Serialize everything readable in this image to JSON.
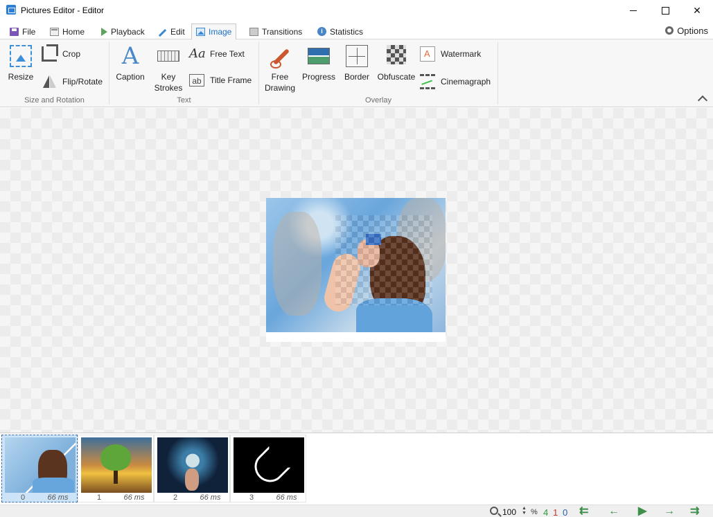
{
  "window": {
    "title": "Pictures Editor - Editor"
  },
  "tabs": [
    {
      "label": "File",
      "icon": "save-icon"
    },
    {
      "label": "Home",
      "icon": "home-icon"
    },
    {
      "label": "Playback",
      "icon": "play-icon"
    },
    {
      "label": "Edit",
      "icon": "pencil-icon"
    },
    {
      "label": "Image",
      "icon": "image-icon",
      "active": true
    },
    {
      "label": "Transitions",
      "icon": "transitions-icon"
    },
    {
      "label": "Statistics",
      "icon": "info-icon"
    }
  ],
  "options_label": "Options",
  "ribbon": {
    "size_rotation": {
      "group_label": "Size and Rotation",
      "resize": "Resize",
      "crop": "Crop",
      "flip_rotate": "Flip/Rotate"
    },
    "text": {
      "group_label": "Text",
      "caption": "Caption",
      "key_strokes_1": "Key",
      "key_strokes_2": "Strokes",
      "free_text": "Free Text",
      "title_frame": "Title Frame"
    },
    "overlay": {
      "group_label": "Overlay",
      "free_drawing_1": "Free",
      "free_drawing_2": "Drawing",
      "progress": "Progress",
      "border": "Border",
      "obfuscate": "Obfuscate",
      "watermark": "Watermark",
      "cinemagraph": "Cinemagraph"
    }
  },
  "frames": [
    {
      "number": "0",
      "delay": "66 ms",
      "selected": true
    },
    {
      "number": "1",
      "delay": "66 ms"
    },
    {
      "number": "2",
      "delay": "66 ms"
    },
    {
      "number": "3",
      "delay": "66 ms"
    }
  ],
  "status": {
    "zoom": "100",
    "zoom_unit": "%",
    "count_total": "4",
    "count_selected": "1",
    "count_index": "0",
    "colors": {
      "total": "#2e9a3a",
      "selected": "#c0392b",
      "index": "#2a5db0",
      "nav": "#3f8f4c"
    }
  }
}
